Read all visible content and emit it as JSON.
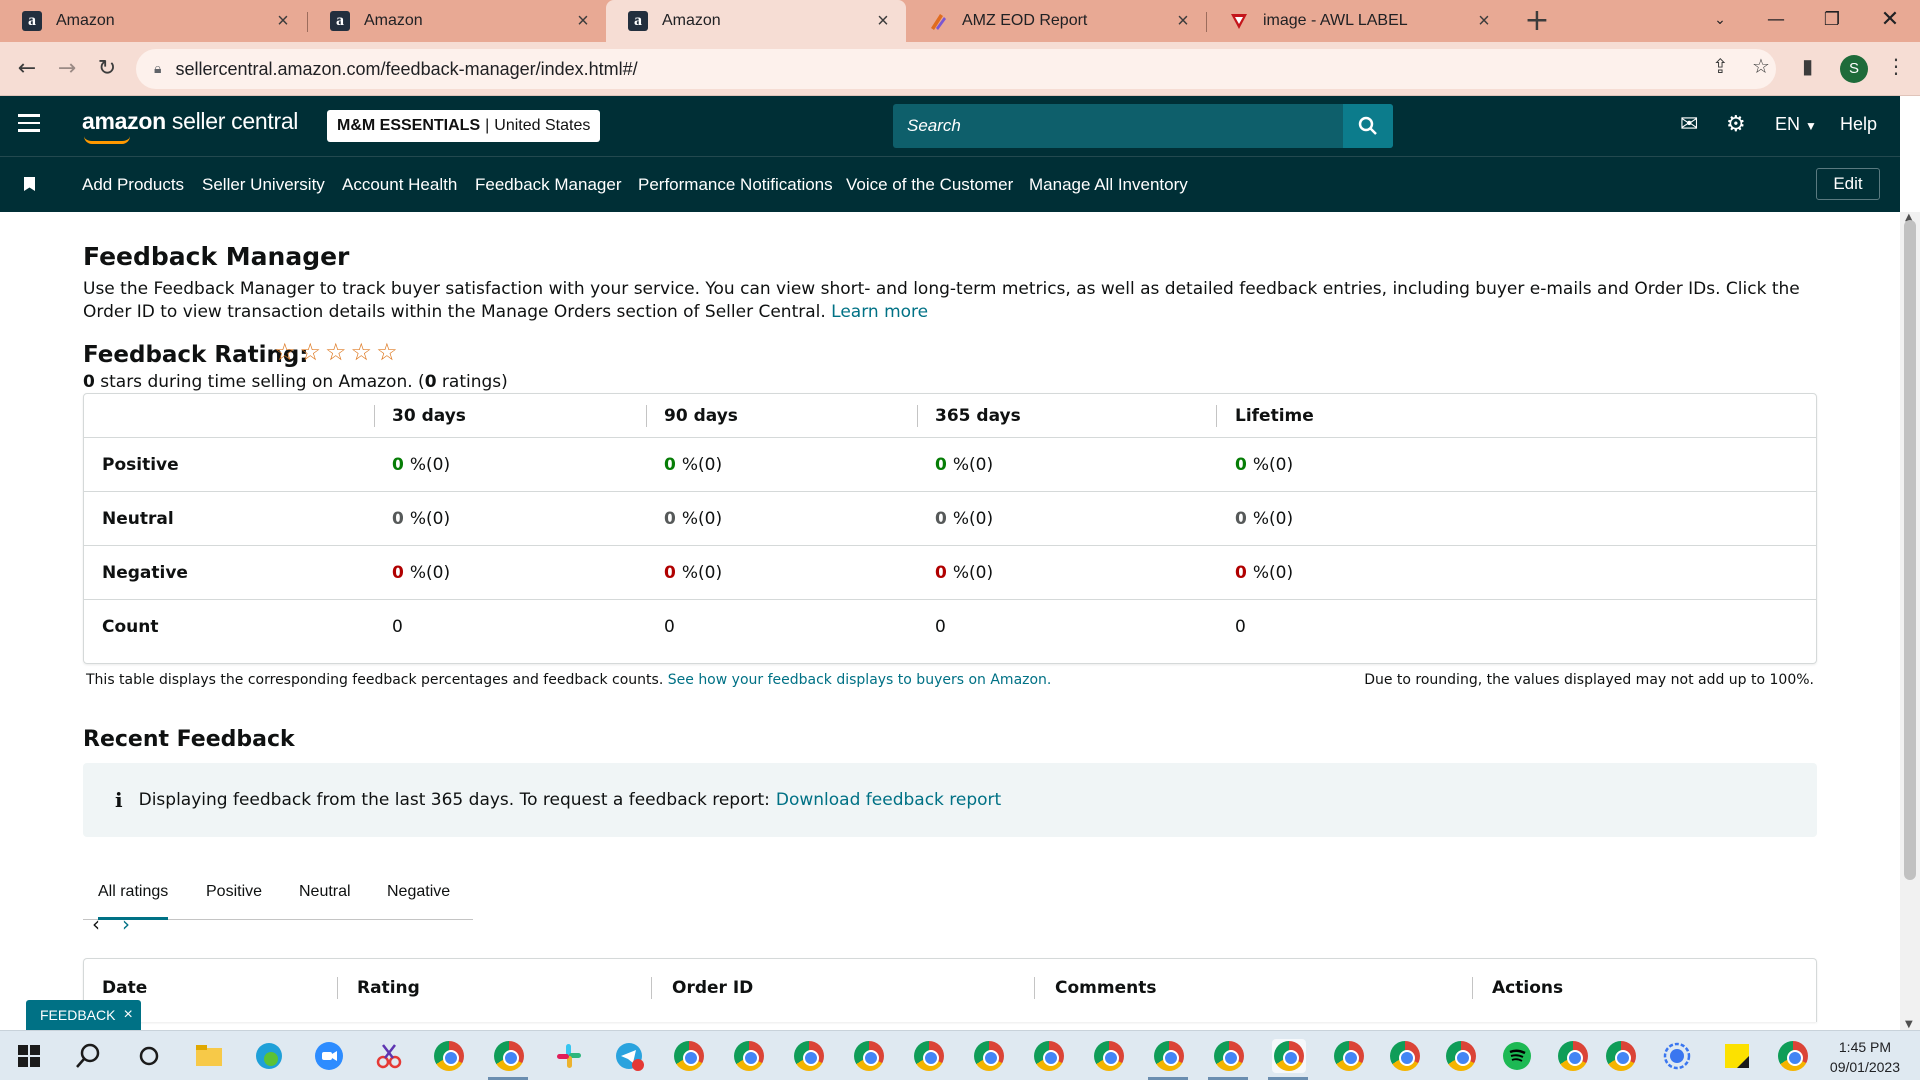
{
  "browser": {
    "tabs": [
      {
        "title": "Amazon",
        "favicon": "amazon-a-icon"
      },
      {
        "title": "Amazon",
        "favicon": "amazon-a-icon"
      },
      {
        "title": "Amazon",
        "favicon": "amazon-a-icon",
        "active": true
      },
      {
        "title": "AMZ EOD Report",
        "favicon": "report-icon"
      },
      {
        "title": "image - AWL LABEL",
        "favicon": "awl-icon"
      }
    ],
    "url": "sellercentral.amazon.com/feedback-manager/index.html#/",
    "profile_initial": "S"
  },
  "header": {
    "logo_bold": "amazon",
    "logo_rest": " seller central",
    "store_name": "M&M ESSENTIALS",
    "store_sep": "|",
    "store_region": "United States",
    "search_placeholder": "Search",
    "language": "EN",
    "help": "Help"
  },
  "nav": {
    "items": [
      "Add Products",
      "Seller University",
      "Account Health",
      "Feedback Manager",
      "Performance Notifications",
      "Voice of the Customer",
      "Manage All Inventory"
    ],
    "edit": "Edit"
  },
  "page": {
    "title": "Feedback Manager",
    "intro": "Use the Feedback Manager to track buyer satisfaction with your service. You can view short- and long-term metrics, as well as detailed feedback entries, including buyer e-mails and Order IDs. Click the Order ID to view transaction details within the Manage Orders section of Seller Central.",
    "learn_more": "Learn more",
    "rating_title": "Feedback Rating:",
    "stars_filled": 0,
    "stars_total": 5,
    "rating_stars": "0",
    "rating_text_mid": " stars during time selling on Amazon. (",
    "rating_count": "0",
    "rating_text_end": " ratings)"
  },
  "feedback_table": {
    "columns": [
      "30 days",
      "90 days",
      "365 days",
      "Lifetime"
    ],
    "rows": [
      {
        "label": "Positive",
        "values": [
          {
            "n": "0",
            "p": "%(0)"
          },
          {
            "n": "0",
            "p": "%(0)"
          },
          {
            "n": "0",
            "p": "%(0)"
          },
          {
            "n": "0",
            "p": "%(0)"
          }
        ]
      },
      {
        "label": "Neutral",
        "values": [
          {
            "n": "0",
            "p": "%(0)"
          },
          {
            "n": "0",
            "p": "%(0)"
          },
          {
            "n": "0",
            "p": "%(0)"
          },
          {
            "n": "0",
            "p": "%(0)"
          }
        ]
      },
      {
        "label": "Negative",
        "values": [
          {
            "n": "0",
            "p": "%(0)"
          },
          {
            "n": "0",
            "p": "%(0)"
          },
          {
            "n": "0",
            "p": "%(0)"
          },
          {
            "n": "0",
            "p": "%(0)"
          }
        ]
      },
      {
        "label": "Count",
        "values": [
          {
            "n": "0"
          },
          {
            "n": "0"
          },
          {
            "n": "0"
          },
          {
            "n": "0"
          }
        ]
      }
    ],
    "footnote": "This table displays the corresponding feedback percentages and feedback counts.",
    "footnote_link": "See how your feedback displays to buyers on Amazon.",
    "rounding_note": "Due to rounding, the values displayed may not add up to 100%."
  },
  "recent": {
    "title": "Recent Feedback",
    "info": "Displaying feedback from the last 365 days. To request a feedback report:",
    "download_link": "Download feedback report",
    "tabs": [
      "All ratings",
      "Positive",
      "Neutral",
      "Negative"
    ],
    "columns": [
      "Date",
      "Rating",
      "Order ID",
      "Comments",
      "Actions"
    ]
  },
  "feedback_pill": "FEEDBACK",
  "taskbar": {
    "time": "1:45 PM",
    "date": "09/01/2023"
  }
}
